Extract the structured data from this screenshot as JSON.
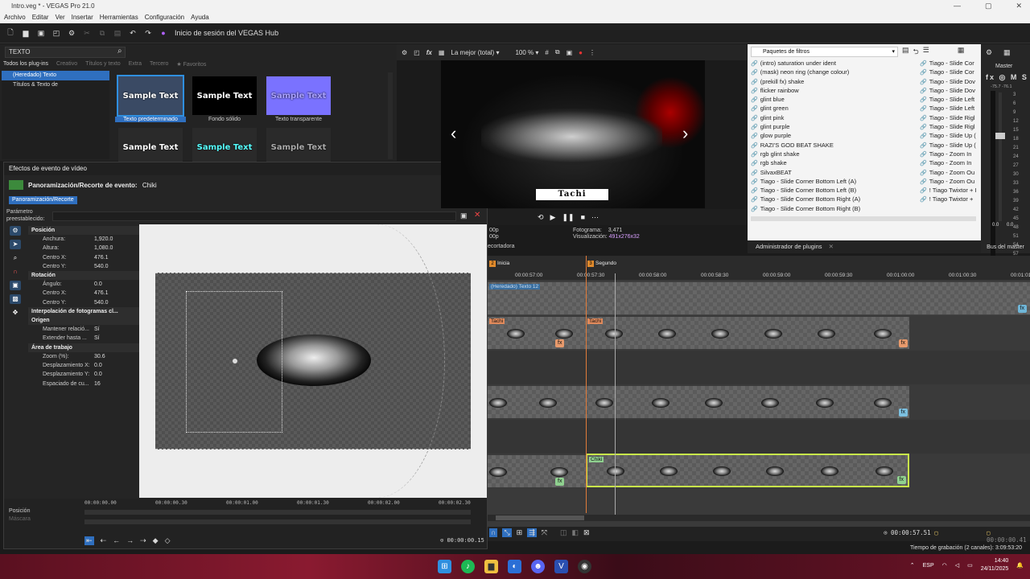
{
  "window": {
    "title": "Intro.veg * - VEGAS Pro 21.0"
  },
  "menu": [
    "Archivo",
    "Editar",
    "Ver",
    "Insertar",
    "Herramientas",
    "Configuración",
    "Ayuda"
  ],
  "toolbar": {
    "hub_label": "Inicio de sesión del VEGAS Hub"
  },
  "plugins": {
    "search_value": "TEXTO",
    "tabs": [
      "Todos los plug-ins",
      "Creativo",
      "Títulos y texto",
      "Extra",
      "Tercero",
      "Favoritos"
    ],
    "tree": [
      "(Heredado) Texto",
      "Títulos & Texto de"
    ],
    "presets": [
      {
        "thumb": "Sample Text",
        "label": "Texto predeterminado",
        "color": "#3a4a64"
      },
      {
        "thumb": "Sample Text",
        "label": "Fondo sólido",
        "color": "#000000"
      },
      {
        "thumb": "Sample Text",
        "label": "Texto transparente",
        "color": "#7a72ff"
      },
      {
        "thumb": "Sample Text",
        "label": "",
        "color": "#2a2a2a"
      },
      {
        "thumb": "Sample Text",
        "label": "",
        "color": "#2a2a2a"
      },
      {
        "thumb": "Sample Text",
        "label": "",
        "color": "#2a2a2a"
      }
    ]
  },
  "vfx": {
    "title": "Efectos de evento de vídeo",
    "header": "Panoramización/Recorte de evento:",
    "event_name": "Chiki",
    "chip": "Panoramización/Recorte",
    "preset_label_1": "Parámetro",
    "preset_label_2": "preestablecido:",
    "sections": [
      {
        "title": "Posición",
        "props": [
          [
            "Anchura:",
            "1,920.0"
          ],
          [
            "Altura:",
            "1,080.0"
          ],
          [
            "Centro X:",
            "476.1"
          ],
          [
            "Centro Y:",
            "540.0"
          ]
        ]
      },
      {
        "title": "Rotación",
        "props": [
          [
            "Ángulo:",
            "0.0"
          ],
          [
            "Centro X:",
            "476.1"
          ],
          [
            "Centro Y:",
            "540.0"
          ]
        ]
      },
      {
        "title": "Interpolación de fotogramas cl...",
        "props": []
      },
      {
        "title": "Origen",
        "props": [
          [
            "Mantener relació...",
            "Sí"
          ],
          [
            "Extender hasta ...",
            "Sí"
          ]
        ]
      },
      {
        "title": "Área de trabajo",
        "props": [
          [
            "Zoom (%):",
            "30.6"
          ],
          [
            "Desplazamiento X:",
            "0.0"
          ],
          [
            "Desplazamiento Y:",
            "0.0"
          ],
          [
            "Espaciado de cu...",
            "16"
          ]
        ]
      }
    ],
    "kf_position_label": "Posición",
    "kf_mask_label": "Máscara",
    "kf_ticks": [
      "00:00:00.00",
      "00:00:00.30",
      "00:00:01.00",
      "00:00:01.30",
      "00:00:02.00",
      "00:00:02.30"
    ],
    "kf_time": "00:00:00.15"
  },
  "preview": {
    "quality": "La mejor (total)",
    "zoom": "100 %",
    "title_text": "Tachi",
    "frame_label": "Fotograma:",
    "frame_value": "3,471",
    "display_label": "Visualización:",
    "display_value": "491x276x32",
    "left_info": [
      "00p",
      "00p"
    ],
    "recorder_label": "ecortadora"
  },
  "filters": {
    "package_label": "Paquetes de filtros",
    "col1": [
      "(intro) saturation under ident",
      "(mask) neon ring (change colour)",
      "(prekill fx) shake",
      "flicker rainbow",
      "glint blue",
      "glint green",
      "glint pink",
      "glint purple",
      "glow purple",
      "RAZI'S GOD BEAT SHAKE",
      "rgb glint shake",
      "rgb shake",
      "SilvaxBEAT",
      "Tiago - Slide Corner Bottom Left (A)",
      "Tiago - Slide Corner Bottom Left (B)",
      "Tiago - Slide Corner Bottom Right (A)",
      "Tiago - Slide Corner Bottom Right (B)"
    ],
    "col2": [
      "Tiago - Slide Cor",
      "Tiago - Slide Cor",
      "Tiago - Slide Dov",
      "Tiago - Slide Dov",
      "Tiago - Slide Left",
      "Tiago - Slide Left",
      "Tiago - Slide Rigl",
      "Tiago - Slide Rigl",
      "Tiago - Slide Up (",
      "Tiago - Slide Up (",
      "Tiago - Zoom In",
      "Tiago - Zoom In",
      "Tiago - Zoom Ou",
      "Tiago - Zoom Ou",
      "! Tiago Twixtor + I",
      "! Tiago Twixtor +"
    ],
    "admin_label": "Administrador de plugins"
  },
  "mixer": {
    "master_label": "Master",
    "fx_row": "fx ◎ M S",
    "levels": [
      "-75.7",
      "-76.1"
    ],
    "scale": [
      "3",
      "6",
      "9",
      "12",
      "15",
      "18",
      "21",
      "24",
      "27",
      "30",
      "33",
      "36",
      "39",
      "42",
      "45",
      "48",
      "51",
      "54",
      "57"
    ],
    "bottom_values": [
      "0.0",
      "0.0"
    ],
    "bus_label": "Bus del master"
  },
  "timeline": {
    "markers": [
      {
        "num": "2",
        "label": "Inicia"
      },
      {
        "num": "3",
        "label": "Segundo"
      }
    ],
    "ticks": [
      "00:00:57:00",
      "00:00:57:30",
      "00:00:58:00",
      "00:00:58:30",
      "00:00:59:00",
      "00:00:59:30",
      "00:01:00:00",
      "00:01:00:30",
      "00:01:01:00"
    ],
    "text_clip_label": "(Heredado) Texto 12",
    "clip_label_tachi": "Tachi",
    "clip_label_chiki": "Chiki",
    "cursor_time": "00:00:57.51",
    "end_time": "00:00:00.41",
    "recording_time": "Tiempo de grabación (2 canales): 3:09:53:20"
  },
  "taskbar": {
    "lang": "ESP",
    "time": "14:40",
    "date": "24/11/2025"
  }
}
